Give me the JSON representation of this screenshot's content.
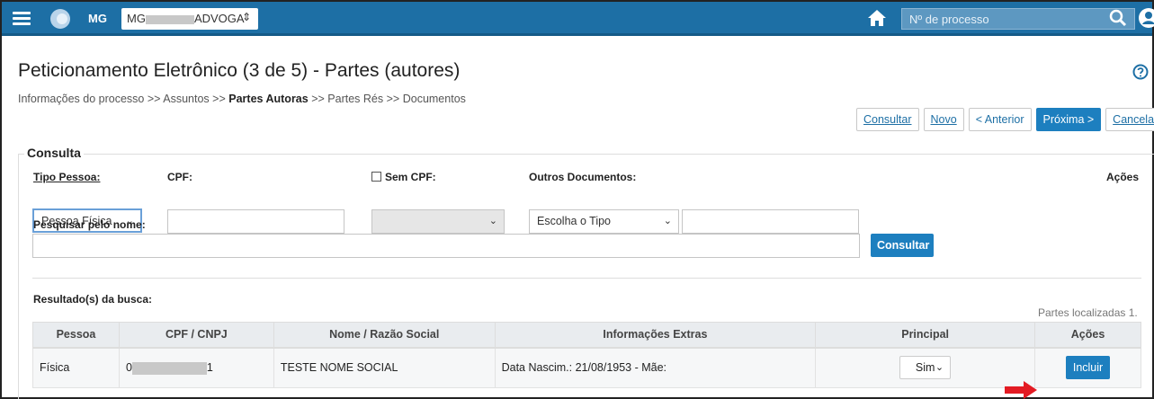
{
  "topbar": {
    "state": "MG",
    "user_select_prefix": "MG",
    "user_select_suffix": "ADVOGA",
    "process_placeholder": "Nº de processo"
  },
  "page": {
    "title": "Peticionamento Eletrônico (3 de 5) - Partes (autores)",
    "breadcrumb": [
      "Informações do processo",
      ">>",
      "Assuntos",
      ">>",
      "Partes Autoras",
      ">>",
      "Partes Rés",
      ">>",
      "Documentos"
    ]
  },
  "buttons": {
    "consultar": "Consultar",
    "novo": "Novo",
    "anterior": "< Anterior",
    "proxima": "Próxima >",
    "cancelar": "Cancelar"
  },
  "consulta": {
    "legend": "Consulta",
    "tipo_pessoa_label": "Tipo Pessoa:",
    "tipo_pessoa_value": "Pessoa Física",
    "cpf_label": "CPF:",
    "sem_cpf_label": "Sem CPF:",
    "outros_label": "Outros Documentos:",
    "outros_value": "Escolha o Tipo",
    "acoes_label": "Ações",
    "pesquisar_label": "Pesquisar pelo nome:",
    "consultar_button": "Consultar"
  },
  "results": {
    "title": "Resultado(s) da busca:",
    "count_text": "Partes localizadas 1.",
    "columns": [
      "Pessoa",
      "CPF / CNPJ",
      "Nome / Razão Social",
      "Informações Extras",
      "Principal",
      "Ações"
    ],
    "rows": [
      {
        "pessoa": "Física",
        "cpf_prefix": "0",
        "cpf_suffix": "1",
        "nome": "TESTE NOME SOCIAL",
        "extras": "Data Nascim.: 21/08/1953 - Mãe:",
        "principal": "Sim",
        "acao": "Incluir"
      }
    ]
  },
  "colors": {
    "topbar": "#1d6fa5",
    "primary_button": "#1d7fbf",
    "arrow": "#e31b23"
  }
}
